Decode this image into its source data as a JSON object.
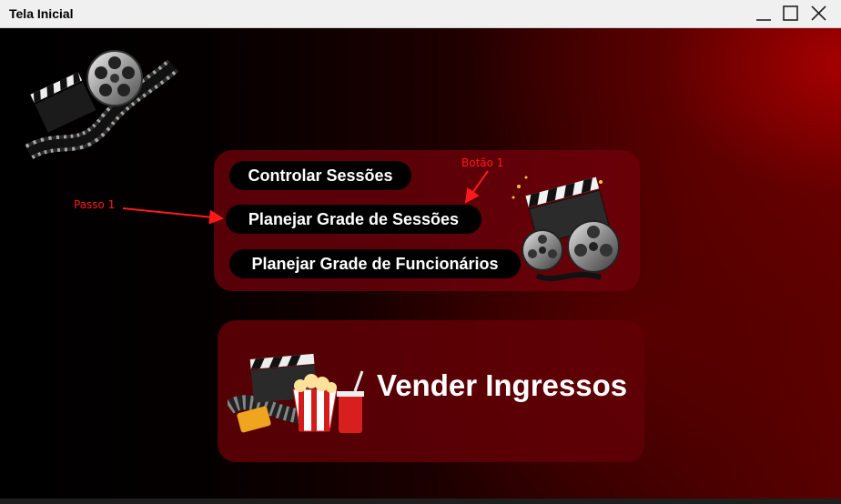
{
  "window": {
    "title": "Tela Inicial",
    "controls": {
      "minimize_icon": "minimize-icon",
      "maximize_icon": "maximize-icon",
      "close_icon": "close-icon"
    }
  },
  "menu": {
    "buttons": [
      {
        "label": "Controlar Sessões"
      },
      {
        "label": "Planejar Grade de Sessões"
      },
      {
        "label": "Planejar Grade de Funcionários"
      }
    ]
  },
  "sell": {
    "label": "Vender Ingressos"
  },
  "annotations": {
    "passo": "Passo 1",
    "botao": "Botão 1"
  },
  "images": {
    "logo": "film-reel-clapper-icon",
    "menu_art": "clapperboard-reels-icon",
    "sell_art": "popcorn-clapper-ticket-icon"
  },
  "colors": {
    "panel": "#70000a",
    "button": "#000000",
    "annotation": "#ff1a1a"
  }
}
